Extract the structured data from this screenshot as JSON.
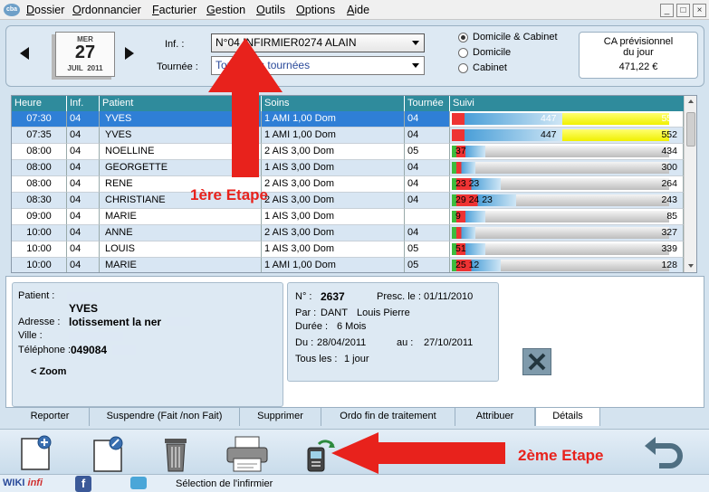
{
  "app": {
    "logo_text": "cba"
  },
  "menu": [
    "Dossier",
    "Ordonnancier",
    "Facturier",
    "Gestion",
    "Outils",
    "Options",
    "Aide"
  ],
  "window_buttons": [
    "_",
    "□",
    "×"
  ],
  "date": {
    "month_top": "MER",
    "day": "27",
    "month_bottom": "JUIL",
    "year": "2011"
  },
  "filters": {
    "inf_label": "Inf. :",
    "inf_value": "N°04  INFIRMIER0274 ALAIN",
    "tournee_label": "Tournée :",
    "tournee_value": "Toutes les tournées"
  },
  "radios": [
    {
      "label": "Domicile & Cabinet",
      "checked": true
    },
    {
      "label": "Domicile",
      "checked": false
    },
    {
      "label": "Cabinet",
      "checked": false
    }
  ],
  "ca": {
    "line1": "CA prévisionnel",
    "line2": "du jour",
    "value": "471,22 €"
  },
  "columns": [
    "Heure",
    "Inf.",
    "Patient",
    "Soins",
    "Tournée",
    "Suivi"
  ],
  "rows": [
    {
      "heure": "07:30",
      "inf": "04",
      "patient": "YVES",
      "soins": "1 AMI 1,00 Dom",
      "tournee": "04",
      "n1": "447",
      "n2": "552",
      "selected": true
    },
    {
      "heure": "07:35",
      "inf": "04",
      "patient": "YVES",
      "soins": "1 AMI 1,00 Dom",
      "tournee": "04",
      "n1": "447",
      "n2": "552",
      "selected": false
    },
    {
      "heure": "08:00",
      "inf": "04",
      "patient": "NOELLINE",
      "soins": "2 AIS 3,00 Dom",
      "tournee": "05",
      "n1": "37",
      "n2": "434",
      "selected": false
    },
    {
      "heure": "08:00",
      "inf": "04",
      "patient": "GEORGETTE",
      "soins": "1 AIS 3,00 Dom",
      "tournee": "04",
      "n1": "",
      "n2": "300",
      "selected": false
    },
    {
      "heure": "08:00",
      "inf": "04",
      "patient": "RENE",
      "soins": "2 AIS 3,00 Dom",
      "tournee": "04",
      "n1": "23  23",
      "n2": "264",
      "selected": false
    },
    {
      "heure": "08:30",
      "inf": "04",
      "patient": "CHRISTIANE",
      "soins": "2 AIS 3,00 Dom",
      "tournee": "04",
      "n1": "29  24  23",
      "n2": "243",
      "selected": false
    },
    {
      "heure": "09:00",
      "inf": "04",
      "patient": "MARIE",
      "soins": "1 AIS 3,00 Dom",
      "tournee": "",
      "n1": "9",
      "n2": "85",
      "selected": false
    },
    {
      "heure": "10:00",
      "inf": "04",
      "patient": "ANNE",
      "soins": "2 AIS 3,00 Dom",
      "tournee": "04",
      "n1": "",
      "n2": "327",
      "selected": false
    },
    {
      "heure": "10:00",
      "inf": "04",
      "patient": "LOUIS",
      "soins": "1 AIS 3,00 Dom",
      "tournee": "05",
      "n1": "51",
      "n2": "339",
      "selected": false
    },
    {
      "heure": "10:00",
      "inf": "04",
      "patient": "MARIE",
      "soins": "1 AMI 1,00 Dom",
      "tournee": "05",
      "n1": "25  12",
      "n2": "128",
      "selected": false
    }
  ],
  "patient": {
    "patient_label": "Patient :",
    "name": "YVES",
    "adresse_label": "Adresse :",
    "adresse": "lotissement la ner",
    "ville_label": "Ville :",
    "tel_label": "Téléphone :",
    "tel": "049084",
    "zoom": "< Zoom"
  },
  "ordo": {
    "num_label": "N° :",
    "num": "2637",
    "presc_label": "Presc. le :",
    "presc": "01/11/2010",
    "par_label": "Par :",
    "par_a": "DANT",
    "par_b": "Louis Pierre",
    "duree_label": "Durée :",
    "duree": "6 Mois",
    "du_label": "Du :",
    "du": "28/04/2011",
    "au_label": "au :",
    "au": "27/10/2011",
    "tous_label": "Tous les :",
    "tous": "1 jour"
  },
  "tabs": [
    "Reporter",
    "Suspendre (Fait /non Fait)",
    "Supprimer",
    "Ordo fin de traitement",
    "Attribuer",
    "Détails"
  ],
  "annotations": {
    "step1": "1ère Etape",
    "step2": "2ème Etape"
  },
  "status": {
    "wiki_a": "WIKI",
    "wiki_b": "infi",
    "text": "Sélection de l'infirmier"
  }
}
